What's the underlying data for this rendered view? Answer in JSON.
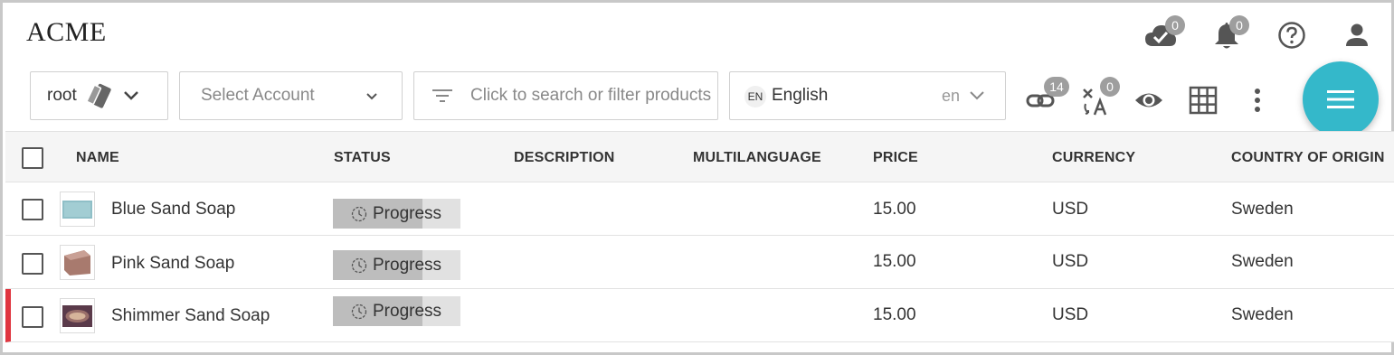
{
  "app": {
    "title": "ACME"
  },
  "top_icons": [
    {
      "name": "cloud-check-icon",
      "badge": "0"
    },
    {
      "name": "bell-icon",
      "badge": "0"
    },
    {
      "name": "help-icon"
    },
    {
      "name": "user-icon"
    }
  ],
  "toolbar": {
    "root_label": "root",
    "account_placeholder": "Select Account",
    "search_placeholder": "Click to search or filter products",
    "language": {
      "code_badge": "EN",
      "label": "English",
      "code": "en"
    },
    "link_badge": "14",
    "translate_badge": "0"
  },
  "table": {
    "columns": [
      "NAME",
      "STATUS",
      "DESCRIPTION",
      "MULTILANGUAGE",
      "PRICE",
      "CURRENCY",
      "COUNTRY OF ORIGIN"
    ],
    "rows": [
      {
        "name": "Blue Sand Soap",
        "status": "Progress",
        "progress": 0.7,
        "price": "15.00",
        "currency": "USD",
        "country": "Sweden",
        "flagged": false
      },
      {
        "name": "Pink Sand Soap",
        "status": "Progress",
        "progress": 0.7,
        "price": "15.00",
        "currency": "USD",
        "country": "Sweden",
        "flagged": false
      },
      {
        "name": "Shimmer Sand Soap",
        "status": "Progress",
        "progress": 0.7,
        "price": "15.00",
        "currency": "USD",
        "country": "Sweden",
        "flagged": true
      }
    ]
  },
  "colors": {
    "accent": "#34b8ca",
    "flag": "#e0353f",
    "badge": "#9e9e9e"
  }
}
